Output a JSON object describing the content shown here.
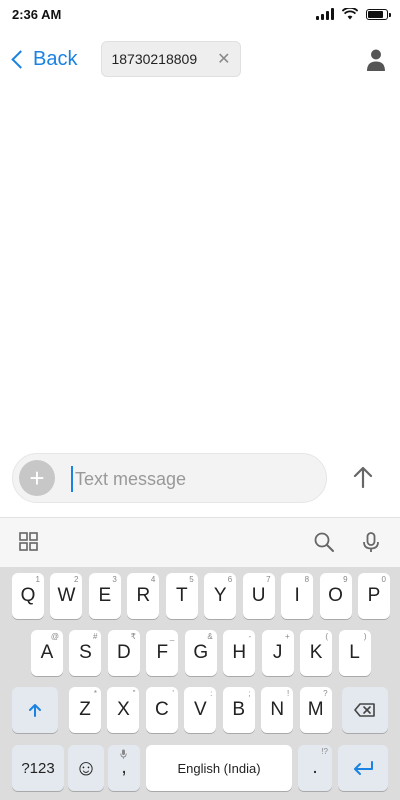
{
  "status": {
    "time": "2:36 AM",
    "battery_level": 0.9
  },
  "header": {
    "back_label": "Back",
    "recipient": "18730218809",
    "chip_close": "✕"
  },
  "compose": {
    "plus": "+",
    "placeholder": "Text message"
  },
  "keyboard": {
    "row1": [
      {
        "label": "Q",
        "hint": "1"
      },
      {
        "label": "W",
        "hint": "2"
      },
      {
        "label": "E",
        "hint": "3"
      },
      {
        "label": "R",
        "hint": "4"
      },
      {
        "label": "T",
        "hint": "5"
      },
      {
        "label": "Y",
        "hint": "6"
      },
      {
        "label": "U",
        "hint": "7"
      },
      {
        "label": "I",
        "hint": "8"
      },
      {
        "label": "O",
        "hint": "9"
      },
      {
        "label": "P",
        "hint": "0"
      }
    ],
    "row2": [
      {
        "label": "A",
        "hint": "@"
      },
      {
        "label": "S",
        "hint": "#"
      },
      {
        "label": "D",
        "hint": "₹"
      },
      {
        "label": "F",
        "hint": "_"
      },
      {
        "label": "G",
        "hint": "&"
      },
      {
        "label": "H",
        "hint": "-"
      },
      {
        "label": "J",
        "hint": "+"
      },
      {
        "label": "K",
        "hint": "("
      },
      {
        "label": "L",
        "hint": ")"
      }
    ],
    "row3": [
      {
        "label": "Z",
        "hint": "*"
      },
      {
        "label": "X",
        "hint": "\""
      },
      {
        "label": "C",
        "hint": "'"
      },
      {
        "label": "V",
        "hint": ":"
      },
      {
        "label": "B",
        "hint": ";"
      },
      {
        "label": "N",
        "hint": "!"
      },
      {
        "label": "M",
        "hint": "?"
      }
    ],
    "numbers_label": "?123",
    "emoji_label": "☺",
    "comma_label": ",",
    "space_label": "English (India)",
    "period_label": ".",
    "period_hint": "!?"
  }
}
